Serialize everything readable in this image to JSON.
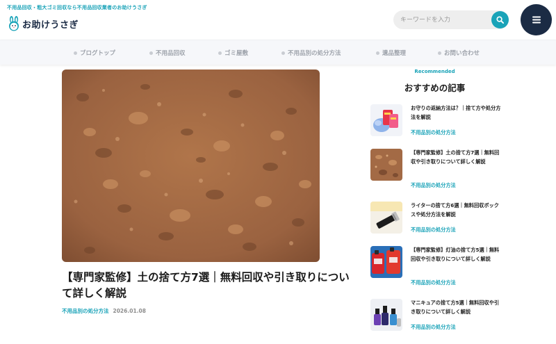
{
  "header": {
    "tagline": "不用品回収・粗大ゴミ回収なら不用品回収業者のお助けうさぎ",
    "logo_text": "お助けうさぎ",
    "search_placeholder": "キーワードを入力"
  },
  "nav": {
    "items": [
      {
        "label": "ブログトップ"
      },
      {
        "label": "不用品回収"
      },
      {
        "label": "ゴミ屋敷"
      },
      {
        "label": "不用品別の処分方法"
      },
      {
        "label": "遺品整理"
      },
      {
        "label": "お問い合わせ"
      }
    ]
  },
  "article": {
    "title": "【専門家監修】土の捨て方7選｜無料回収や引き取りについて詳しく解説",
    "category": "不用品別の処分方法",
    "date": "2026.01.08"
  },
  "sidebar": {
    "eyebrow": "Recommended",
    "heading": "おすすめの記事",
    "items": [
      {
        "title": "お守りの返納方法は？｜捨て方や処分方法を解説",
        "category": "不用品別の処分方法",
        "thumb": "omamori-thumbnail"
      },
      {
        "title": "【専門家監修】土の捨て方7選｜無料回収や引き取りについて詳しく解説",
        "category": "不用品別の処分方法",
        "thumb": "soil-thumbnail"
      },
      {
        "title": "ライターの捨て方6選｜無料回収ボックスや処分方法を解説",
        "category": "不用品別の処分方法",
        "thumb": "lighter-thumbnail"
      },
      {
        "title": "【専門家監修】灯油の捨て方5選｜無料回収や引き取りについて詳しく解説",
        "category": "不用品別の処分方法",
        "thumb": "kerosene-thumbnail"
      },
      {
        "title": "マニキュアの捨て方5選｜無料回収や引き取りについて詳しく解説",
        "category": "不用品別の処分方法",
        "thumb": "nail-polish-thumbnail"
      }
    ]
  },
  "colors": {
    "accent": "#1aa3b8",
    "navy": "#1b2b44",
    "nav_text": "#9ea3ab"
  }
}
